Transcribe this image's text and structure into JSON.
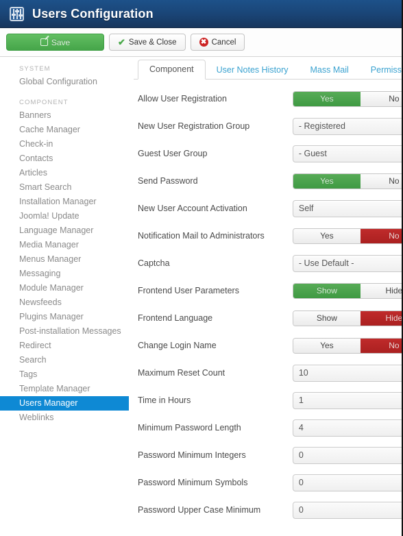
{
  "header": {
    "title": "Users Configuration",
    "icon": "sliders-icon"
  },
  "toolbar": {
    "save_label": "Save",
    "save_close_label": "Save & Close",
    "cancel_label": "Cancel"
  },
  "sidebar": {
    "system_heading": "SYSTEM",
    "system_items": [
      {
        "label": "Global Configuration",
        "active": false
      }
    ],
    "component_heading": "COMPONENT",
    "component_items": [
      {
        "label": "Banners",
        "active": false
      },
      {
        "label": "Cache Manager",
        "active": false
      },
      {
        "label": "Check-in",
        "active": false
      },
      {
        "label": "Contacts",
        "active": false
      },
      {
        "label": "Articles",
        "active": false
      },
      {
        "label": "Smart Search",
        "active": false
      },
      {
        "label": "Installation Manager",
        "active": false
      },
      {
        "label": "Joomla! Update",
        "active": false
      },
      {
        "label": "Language Manager",
        "active": false
      },
      {
        "label": "Media Manager",
        "active": false
      },
      {
        "label": "Menus Manager",
        "active": false
      },
      {
        "label": "Messaging",
        "active": false
      },
      {
        "label": "Module Manager",
        "active": false
      },
      {
        "label": "Newsfeeds",
        "active": false
      },
      {
        "label": "Plugins Manager",
        "active": false
      },
      {
        "label": "Post-installation Messages",
        "active": false
      },
      {
        "label": "Redirect",
        "active": false
      },
      {
        "label": "Search",
        "active": false
      },
      {
        "label": "Tags",
        "active": false
      },
      {
        "label": "Template Manager",
        "active": false
      },
      {
        "label": "Users Manager",
        "active": true
      },
      {
        "label": "Weblinks",
        "active": false
      }
    ]
  },
  "tabs": [
    {
      "label": "Component",
      "active": true
    },
    {
      "label": "User Notes History",
      "active": false
    },
    {
      "label": "Mass Mail",
      "active": false
    },
    {
      "label": "Permissions",
      "active": false
    }
  ],
  "fields": [
    {
      "label": "Allow User Registration",
      "type": "toggle",
      "options": [
        "Yes",
        "No"
      ],
      "selected": "Yes",
      "state": "green"
    },
    {
      "label": "New User Registration Group",
      "type": "select",
      "value": "- Registered"
    },
    {
      "label": "Guest User Group",
      "type": "select",
      "value": "- Guest"
    },
    {
      "label": "Send Password",
      "type": "toggle",
      "options": [
        "Yes",
        "No"
      ],
      "selected": "Yes",
      "state": "green"
    },
    {
      "label": "New User Account Activation",
      "type": "select",
      "value": "Self"
    },
    {
      "label": "Notification Mail to Administrators",
      "type": "toggle",
      "options": [
        "Yes",
        "No"
      ],
      "selected": "No",
      "state": "red"
    },
    {
      "label": "Captcha",
      "type": "select",
      "value": "- Use Default -"
    },
    {
      "label": "Frontend User Parameters",
      "type": "toggle",
      "options": [
        "Show",
        "Hide"
      ],
      "selected": "Show",
      "state": "green"
    },
    {
      "label": "Frontend Language",
      "type": "toggle",
      "options": [
        "Show",
        "Hide"
      ],
      "selected": "Hide",
      "state": "red"
    },
    {
      "label": "Change Login Name",
      "type": "toggle",
      "options": [
        "Yes",
        "No"
      ],
      "selected": "No",
      "state": "red"
    },
    {
      "label": "Maximum Reset Count",
      "type": "select",
      "value": "10"
    },
    {
      "label": "Time in Hours",
      "type": "select",
      "value": "1"
    },
    {
      "label": "Minimum Password Length",
      "type": "select",
      "value": "4"
    },
    {
      "label": "Password Minimum Integers",
      "type": "select",
      "value": "0"
    },
    {
      "label": "Password Minimum Symbols",
      "type": "select",
      "value": "0"
    },
    {
      "label": "Password Upper Case Minimum",
      "type": "select",
      "value": "0"
    }
  ],
  "colors": {
    "header_blue": "#1a4577",
    "active_item_blue": "#0e89d4",
    "toggle_green": "#3f9a43",
    "toggle_red": "#ab2020",
    "save_green": "#45a549",
    "tab_link": "#3aa2d0"
  }
}
